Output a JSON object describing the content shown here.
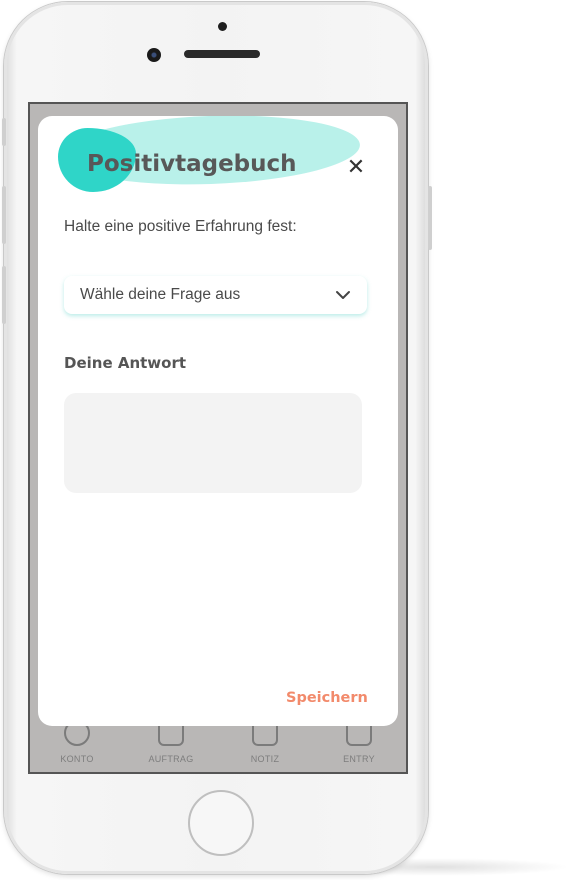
{
  "modal": {
    "title": "Positivtagebuch",
    "close_icon": "close-icon",
    "subtitle": "Halte eine positive Erfahrung fest:",
    "question_select": {
      "selected": "Wähle deine Frage aus",
      "icon": "chevron-down-icon"
    },
    "answer_label": "Deine Antwort",
    "answer_value": "",
    "save_label": "Speichern",
    "colors": {
      "accent_teal": "#2fd5c8",
      "accent_teal_light": "#b9f1ea",
      "save_orange": "#f28a6b"
    }
  },
  "tabbar": {
    "items": [
      {
        "label": "KONTO",
        "icon": "user-icon"
      },
      {
        "label": "AUFTRAG",
        "icon": "clipboard-icon"
      },
      {
        "label": "NOTIZ",
        "icon": "note-icon"
      },
      {
        "label": "ENTRY",
        "icon": "plus-square-icon"
      }
    ]
  }
}
